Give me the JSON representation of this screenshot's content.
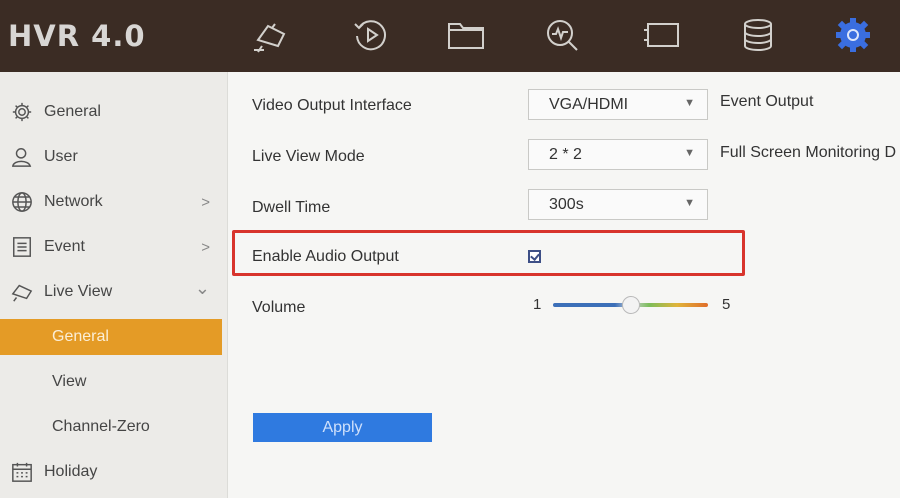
{
  "header": {
    "logo": "HVR 4.0",
    "icons": [
      "camera-icon",
      "playback-icon",
      "folder-icon",
      "search-analysis-icon",
      "monitor-icon",
      "storage-icon",
      "settings-gear-icon"
    ],
    "active_icon_color": "#3a6ee0"
  },
  "sidebar": {
    "items": [
      {
        "label": "General",
        "icon": "gear-icon"
      },
      {
        "label": "User",
        "icon": "user-icon"
      },
      {
        "label": "Network",
        "icon": "globe-icon",
        "arrow": ">"
      },
      {
        "label": "Event",
        "icon": "event-list-icon",
        "arrow": ">"
      },
      {
        "label": "Live View",
        "icon": "live-view-camera-icon",
        "arrow": "⌄"
      },
      {
        "label": "General",
        "active": true
      },
      {
        "label": "View"
      },
      {
        "label": "Channel-Zero"
      },
      {
        "label": "Holiday",
        "icon": "calendar-icon"
      }
    ],
    "active_color": "#e49b26"
  },
  "form": {
    "video_output": {
      "label": "Video Output Interface",
      "value": "VGA/HDMI"
    },
    "live_view_mode": {
      "label": "Live View Mode",
      "value": "2 * 2"
    },
    "dwell_time": {
      "label": "Dwell Time",
      "value": "300s"
    },
    "event_output_label": "Event Output",
    "full_screen_label": "Full Screen Monitoring D",
    "enable_audio": {
      "label": "Enable Audio Output",
      "checked": true
    },
    "volume": {
      "label": "Volume",
      "min": "1",
      "max": "5",
      "level": 0.5
    },
    "apply_label": "Apply",
    "highlight_color": "#d8342c"
  }
}
